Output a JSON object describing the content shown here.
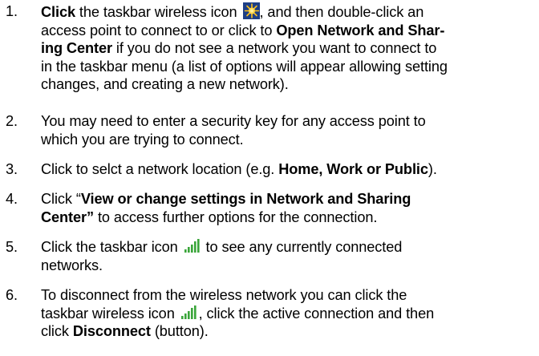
{
  "steps": [
    {
      "number": "1.",
      "l1_bold": "Click",
      "l1_text": " the taskbar wireless icon ",
      "l1_text2": ", and then double-click an",
      "l2_text": "access point to connect to or click to ",
      "l2_bold": "Open Network and Shar-",
      "l3_bold": "ing Center",
      "l3_text": " if you do not see a network you want to connect to",
      "l4_text": "in the taskbar menu (a list of options will appear allowing setting",
      "l5_text": "changes, and creating a new network)."
    },
    {
      "number": "2.",
      "l1_text": "You may need to enter a security key for any access point to",
      "l2_text": "which you are trying to connect."
    },
    {
      "number": "3.",
      "l1_text": "Click to selct a network location (e.g. ",
      "l1_bold": "Home, Work or Public",
      "l1_text2": ")."
    },
    {
      "number": "4.",
      "l1_text": "Click “",
      "l1_bold": "View or change settings in Network and Sharing",
      "l2_bold": "Center”",
      "l2_text": " to access further options for the connection."
    },
    {
      "number": "5.",
      "l1_text": "Click the taskbar icon ",
      "l1_text2": " to see any currently connected",
      "l2_text": "networks."
    },
    {
      "number": "6.",
      "l1_text": "To disconnect from the wireless network you can click the",
      "l2_text": "taskbar wireless icon ",
      "l2_text2": ", click the active connection and then",
      "l3_text": "click ",
      "l3_bold": "Disconnect",
      "l3_text2": " (button)."
    }
  ],
  "icons": {
    "wireless_icon": "wireless-sunburst-icon",
    "signal_icon": "signal-bars-icon"
  },
  "colors": {
    "text": "#000000",
    "wireless_icon_bg": "#1d3f86",
    "wireless_icon_burst": "#ffc21a",
    "signal_bars": "#3aa53a"
  }
}
